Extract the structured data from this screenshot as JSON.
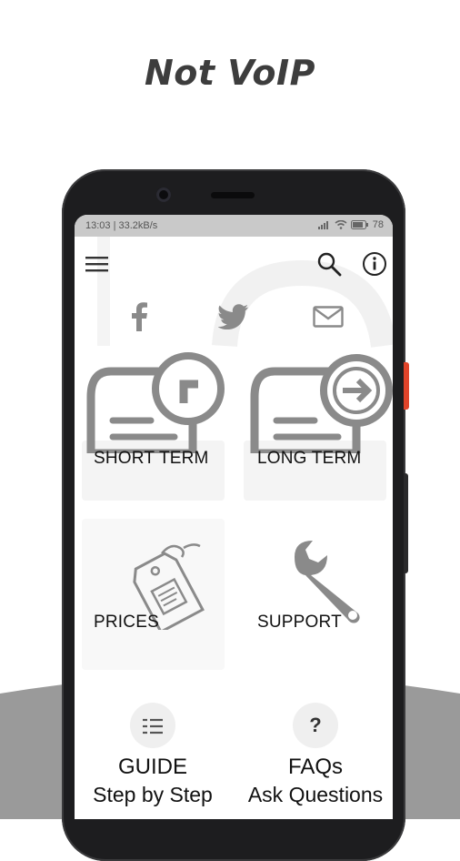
{
  "headline": "Not VoIP",
  "status_bar": {
    "time_speed": "13:03 | 33.2kB/s",
    "battery": "78"
  },
  "toolbar": {
    "menu_icon": "hamburger-menu-icon",
    "search_icon": "search-icon",
    "info_icon": "info-icon"
  },
  "social": {
    "facebook_icon": "facebook-icon",
    "twitter_icon": "twitter-icon",
    "email_icon": "email-icon"
  },
  "cards": {
    "short_term": "SHORT TERM",
    "long_term": "LONG TERM",
    "prices": "PRICES",
    "support": "SUPPORT"
  },
  "bottom": {
    "guide_title": "GUIDE",
    "guide_sub": "Step by Step",
    "faq_title": "FAQs",
    "faq_sub": "Ask Questions",
    "faq_icon_text": "?"
  },
  "colors": {
    "accent_red": "#e0442a",
    "icon_gray": "#8a8a8a",
    "band_gray": "#9a9a9a"
  }
}
